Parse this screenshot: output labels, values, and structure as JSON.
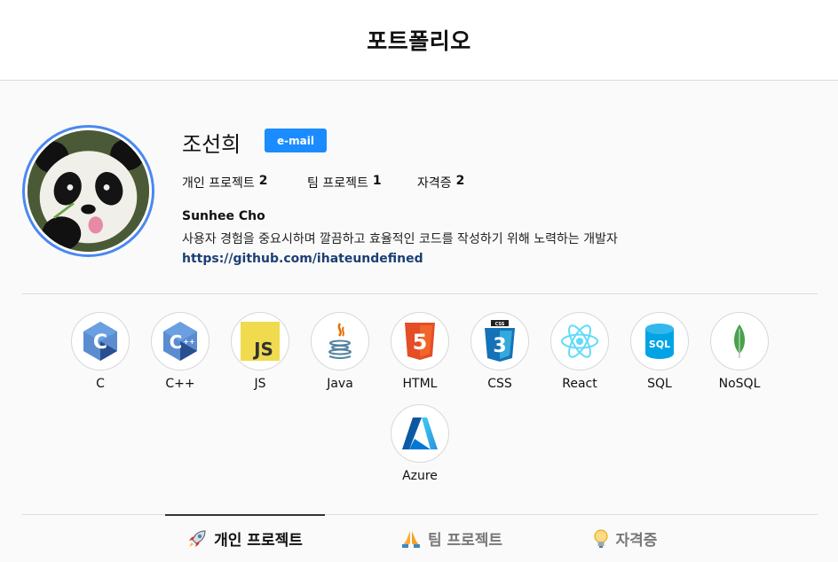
{
  "header": {
    "title": "포트폴리오"
  },
  "profile": {
    "username": "조선희",
    "email_label": "e-mail",
    "stats": [
      {
        "label": "개인 프로젝트",
        "count": "2"
      },
      {
        "label": "팀 프로젝트",
        "count": "1"
      },
      {
        "label": "자격증",
        "count": "2"
      }
    ],
    "full_name": "Sunhee Cho",
    "bio": "사용자 경험을 중요시하며 깔끔하고 효율적인 코드를 작성하기 위해 노력하는 개발자",
    "link": "https://github.com/ihateundefined"
  },
  "skills": [
    {
      "label": "C",
      "icon": "c-logo-icon"
    },
    {
      "label": "C++",
      "icon": "cpp-logo-icon"
    },
    {
      "label": "JS",
      "icon": "javascript-logo-icon"
    },
    {
      "label": "Java",
      "icon": "java-logo-icon"
    },
    {
      "label": "HTML",
      "icon": "html5-logo-icon"
    },
    {
      "label": "CSS",
      "icon": "css3-logo-icon"
    },
    {
      "label": "React",
      "icon": "react-logo-icon"
    },
    {
      "label": "SQL",
      "icon": "sql-logo-icon"
    },
    {
      "label": "NoSQL",
      "icon": "mongodb-leaf-icon"
    },
    {
      "label": "Azure",
      "icon": "azure-logo-icon"
    }
  ],
  "tabs": [
    {
      "label": "개인 프로젝트",
      "icon": "rocket-icon",
      "active": true
    },
    {
      "label": "팀 프로젝트",
      "icon": "praying-hands-icon",
      "active": false
    },
    {
      "label": "자격증",
      "icon": "lightbulb-icon",
      "active": false
    }
  ],
  "colors": {
    "accent": "#1a8cff",
    "avatar_ring": "#4a88f0",
    "link": "#1c3f73"
  }
}
